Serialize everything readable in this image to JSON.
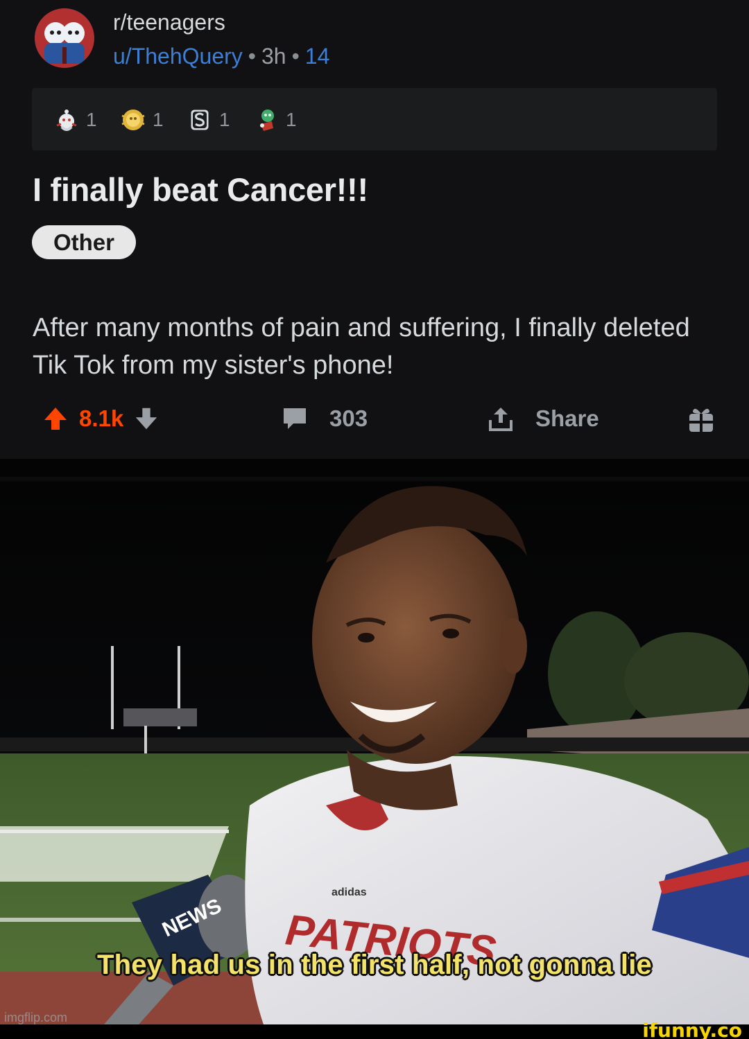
{
  "header": {
    "subreddit": "r/teenagers",
    "username": "u/ThehQuery",
    "separator": "•",
    "age": "3h",
    "count": "14"
  },
  "awards": [
    {
      "icon": "wholesome-award-icon",
      "count": "1"
    },
    {
      "icon": "gold-award-icon",
      "count": "1"
    },
    {
      "icon": "silver-award-icon",
      "count": "1"
    },
    {
      "icon": "helpful-award-icon",
      "count": "1"
    }
  ],
  "post": {
    "title": "I finally beat Cancer!!!",
    "flair": "Other",
    "body": "After many months of pain and suffering, I finally deleted Tik Tok from my sister's phone!"
  },
  "actions": {
    "upvotes": "8.1k",
    "comments": "303",
    "share_label": "Share"
  },
  "meme": {
    "caption": "They had us in the first half, not gonna lie",
    "watermark": "imgflip.com",
    "jersey_brand": "adidas",
    "jersey_text": "PATRIOTS",
    "mic_text": "NEWS"
  },
  "footer": {
    "site": "ifunny.co"
  },
  "colors": {
    "upvote": "#ff4500",
    "link": "#3c7fd6",
    "caption": "#f4e36a"
  }
}
